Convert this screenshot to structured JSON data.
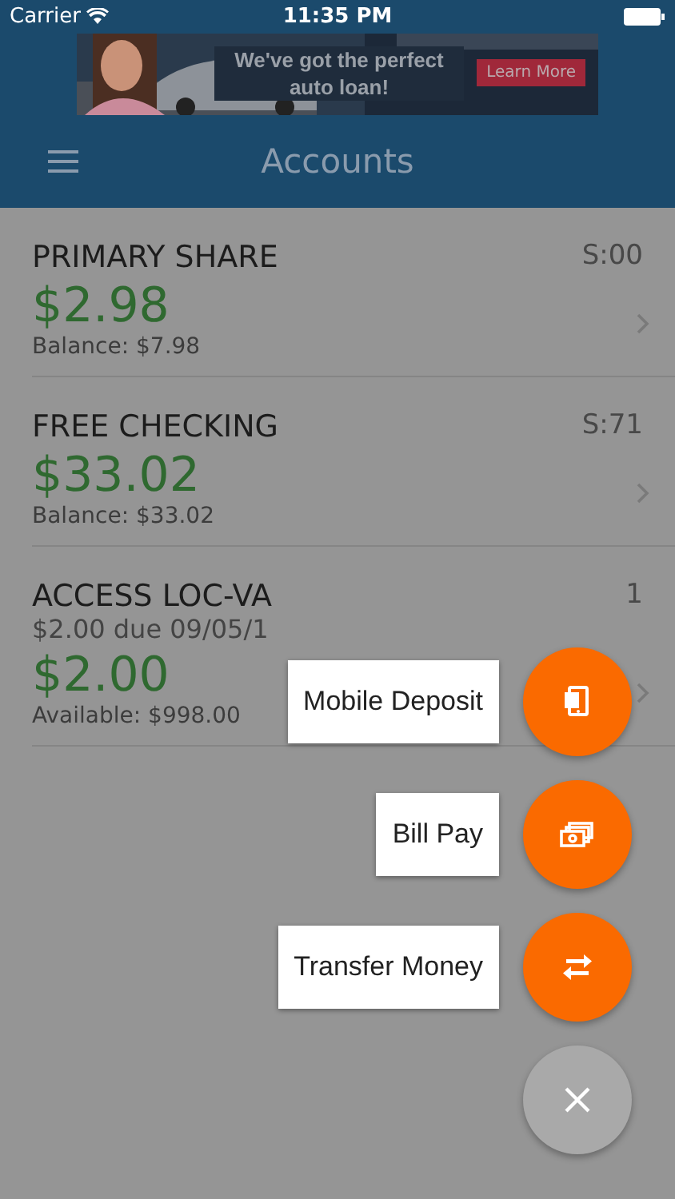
{
  "status_bar": {
    "carrier": "Carrier",
    "time": "11:35 PM"
  },
  "ad_banner": {
    "headline": "We've got the perfect auto loan!",
    "button": "Learn More"
  },
  "nav": {
    "title": "Accounts"
  },
  "accounts": [
    {
      "name": "PRIMARY SHARE",
      "id": "S:00",
      "amount": "$2.98",
      "balance": "Balance: $7.98"
    },
    {
      "name": "FREE CHECKING",
      "id": "S:71",
      "amount": "$33.02",
      "balance": "Balance: $33.02"
    },
    {
      "name": "ACCESS LOC-VA",
      "id": "1",
      "note": "$2.00 due 09/05/1",
      "amount": "$2.00",
      "balance": "Available: $998.00"
    }
  ],
  "actions": [
    {
      "label": "Mobile Deposit",
      "kind": "deposit"
    },
    {
      "label": "Bill Pay",
      "kind": "bill"
    },
    {
      "label": "Transfer Money",
      "kind": "transfer"
    }
  ]
}
